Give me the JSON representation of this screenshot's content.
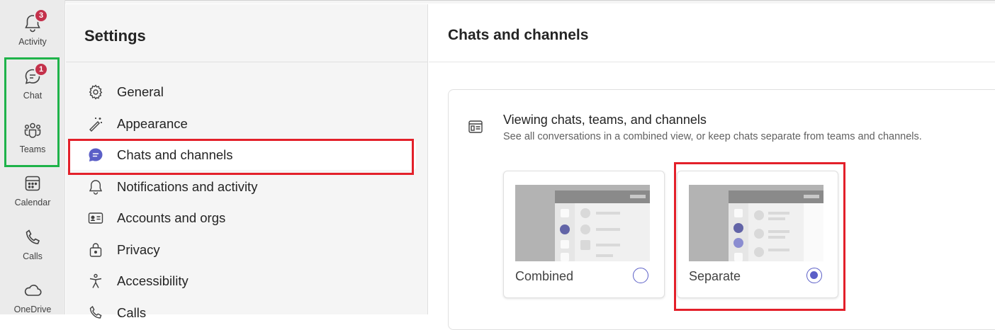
{
  "rail": {
    "items": [
      {
        "label": "Activity",
        "icon": "bell-icon",
        "badge": "3"
      },
      {
        "label": "Chat",
        "icon": "chat-icon",
        "badge": "1"
      },
      {
        "label": "Teams",
        "icon": "teams-icon"
      },
      {
        "label": "Calendar",
        "icon": "calendar-icon"
      },
      {
        "label": "Calls",
        "icon": "phone-icon"
      },
      {
        "label": "OneDrive",
        "icon": "cloud-icon"
      }
    ]
  },
  "settings": {
    "title": "Settings",
    "nav": [
      {
        "label": "General",
        "icon": "gear-icon"
      },
      {
        "label": "Appearance",
        "icon": "magic-wand-icon"
      },
      {
        "label": "Chats and channels",
        "icon": "chat-bubble-icon",
        "active": true
      },
      {
        "label": "Notifications and activity",
        "icon": "bell-icon"
      },
      {
        "label": "Accounts and orgs",
        "icon": "id-card-icon"
      },
      {
        "label": "Privacy",
        "icon": "lock-icon"
      },
      {
        "label": "Accessibility",
        "icon": "accessibility-icon"
      },
      {
        "label": "Calls",
        "icon": "phone-icon"
      }
    ]
  },
  "main": {
    "title": "Chats and channels",
    "section": {
      "title": "Viewing chats, teams, and channels",
      "description": "See all conversations in a combined view, or keep chats separate from teams and channels.",
      "icon": "layout-icon",
      "options": [
        {
          "label": "Combined",
          "selected": false
        },
        {
          "label": "Separate",
          "selected": true
        }
      ]
    }
  },
  "colors": {
    "accent": "#5b5fc7",
    "badge": "#c4314b",
    "highlight_red": "#e3202a",
    "highlight_green": "#1fb34a"
  }
}
